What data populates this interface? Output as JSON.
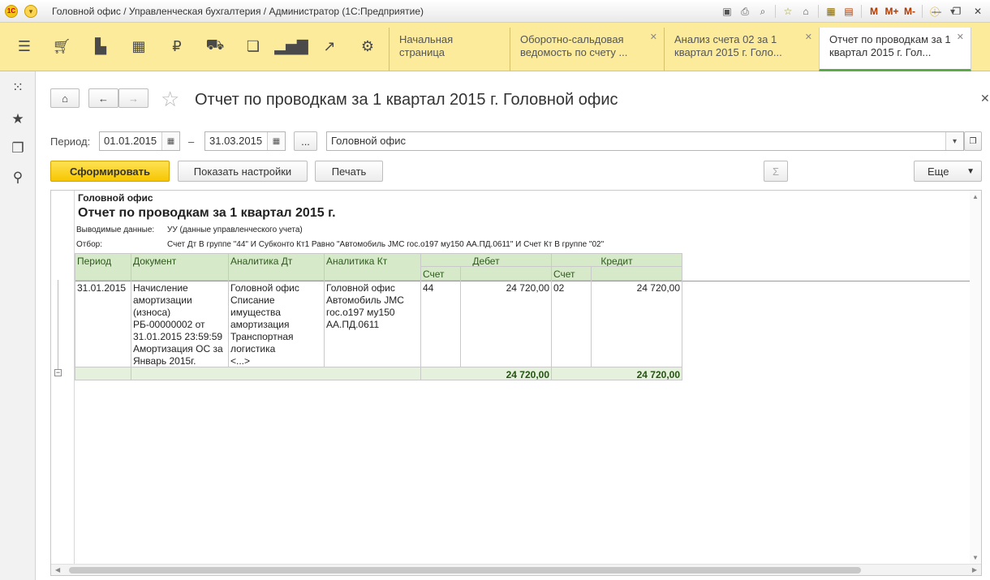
{
  "window": {
    "title": "Головной офис / Управленческая бухгалтерия / Администратор  (1С:Предприятие)",
    "toolbar_memory": [
      "M",
      "M+",
      "M-"
    ]
  },
  "tabs": [
    {
      "label": "Начальная страница",
      "closable": false
    },
    {
      "label": "Оборотно-сальдовая ведомость по счету ...",
      "closable": true
    },
    {
      "label": "Анализ счета 02 за 1 квартал 2015 г. Голо...",
      "closable": true
    },
    {
      "label": "Отчет по проводкам за 1 квартал 2015 г. Гол...",
      "closable": true,
      "active": true
    }
  ],
  "form": {
    "title": "Отчет по проводкам за 1 квартал 2015 г. Головной офис",
    "period_label": "Период:",
    "date_from": "01.01.2015",
    "dash": "–",
    "date_to": "31.03.2015",
    "dots": "...",
    "organization": "Головной офис",
    "btn_generate": "Сформировать",
    "btn_settings": "Показать настройки",
    "btn_print": "Печать",
    "btn_more": "Еще",
    "sum_symbol": "Σ"
  },
  "report": {
    "org": "Головной офис",
    "heading": "Отчет по проводкам за 1 квартал 2015 г.",
    "output_label": "Выводимые данные:",
    "output_value": "УУ (данные управленческого учета)",
    "filter_label": "Отбор:",
    "filter_value": "Счет Дт В группе \"44\" И Субконто Кт1 Равно \"Автомобиль JMC гос.о197 му150 АА.ПД.0611\" И Счет Кт В группе \"02\"",
    "columns": {
      "period": "Период",
      "document": "Документ",
      "analytics_dt": "Аналитика Дт",
      "analytics_kt": "Аналитика Кт",
      "debit": "Дебет",
      "credit": "Кредит",
      "account": "Счет"
    },
    "row": {
      "period": "31.01.2015",
      "document_lines": [
        "Начисление",
        "амортизации",
        "(износа)",
        "РБ-00000002 от",
        "31.01.2015 23:59:59",
        "Амортизация ОС за",
        "Январь 2015г."
      ],
      "analytics_dt_lines": [
        "Головной офис",
        "Списание",
        "имущества",
        "амортизация",
        "Транспортная",
        "логистика",
        "<...>"
      ],
      "analytics_kt_lines": [
        "Головной офис",
        "Автомобиль JMC",
        "гос.о197 му150",
        "АА.ПД.0611"
      ],
      "debit_account": "44",
      "debit_amount": "24 720,00",
      "credit_account": "02",
      "credit_amount": "24 720,00"
    },
    "total": {
      "debit": "24 720,00",
      "credit": "24 720,00"
    }
  },
  "icons": {
    "sections": [
      "menu-icon",
      "cart-icon",
      "bag-icon",
      "warehouse-icon",
      "ruble-icon",
      "truck-icon",
      "documents-icon",
      "bar-chart-icon",
      "trend-icon",
      "gear-icon"
    ],
    "left_panel": [
      "apps-grid-icon",
      "star-icon",
      "history-icon",
      "search-icon"
    ]
  }
}
